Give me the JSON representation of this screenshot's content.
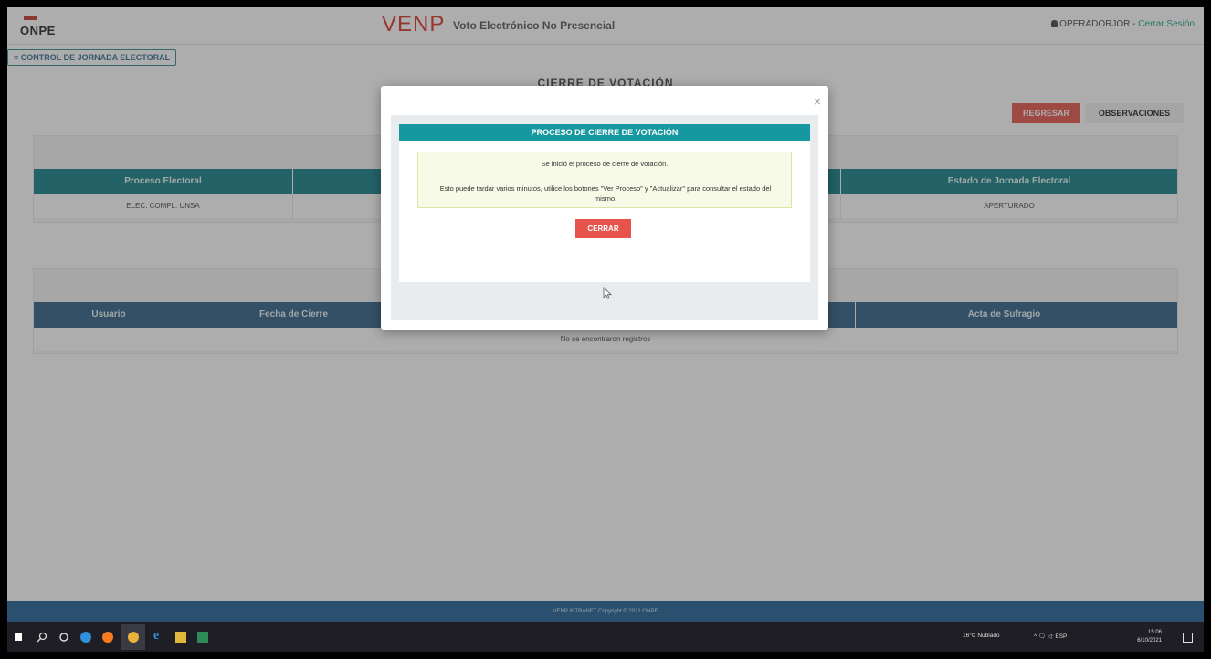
{
  "header": {
    "org_logo": "ONPE",
    "app_logo": "VENP",
    "app_subtitle": "Voto Electrónico No Presencial",
    "user": "OPERADORJOR",
    "separator": " - ",
    "logout_label": "Cerrar Sesión"
  },
  "nav": {
    "section_label": "≡ CONTROL DE JORNADA ELECTORAL"
  },
  "page": {
    "title": "CIERRE DE VOTACIÓN",
    "back_button": "REGRESAR",
    "observations_button": "OBSERVACIONES"
  },
  "jornada_table": {
    "headers": [
      "Proceso Electoral",
      "",
      "",
      "Estado de Jornada Electoral"
    ],
    "rows": [
      [
        "ELEC. COMPL. UNSA",
        "",
        "",
        "APERTURADO"
      ]
    ]
  },
  "cierres_table": {
    "headers": [
      "Usuario",
      "Fecha de Cierre",
      "",
      "Acta de Sufragio"
    ],
    "empty_message": "No se encontraron registros"
  },
  "modal": {
    "close_symbol": "×",
    "title": "PROCESO DE CIERRE DE VOTACIÓN",
    "message_line1": "Se inició el proceso de cierre de votación.",
    "message_line2": "Esto puede tardar varios minutos, utilice los botones \"Ver Proceso\" y \"Actualizar\" para consultar el estado del mismo.",
    "close_button": "CERRAR"
  },
  "footer": {
    "text": "VENP INTRANET Copyright © 2021 ONPE"
  },
  "taskbar": {
    "weather": "16°C Nublado",
    "tray": "^ 🗨 ◁ᐧ ESP",
    "time": "15:06",
    "date": "6/10/2021"
  },
  "colors": {
    "accent_teal": "#127f86",
    "accent_blue": "#2f5f86",
    "danger": "#e5534b",
    "footer": "#1f5f95",
    "brand_red": "#d9342b"
  }
}
